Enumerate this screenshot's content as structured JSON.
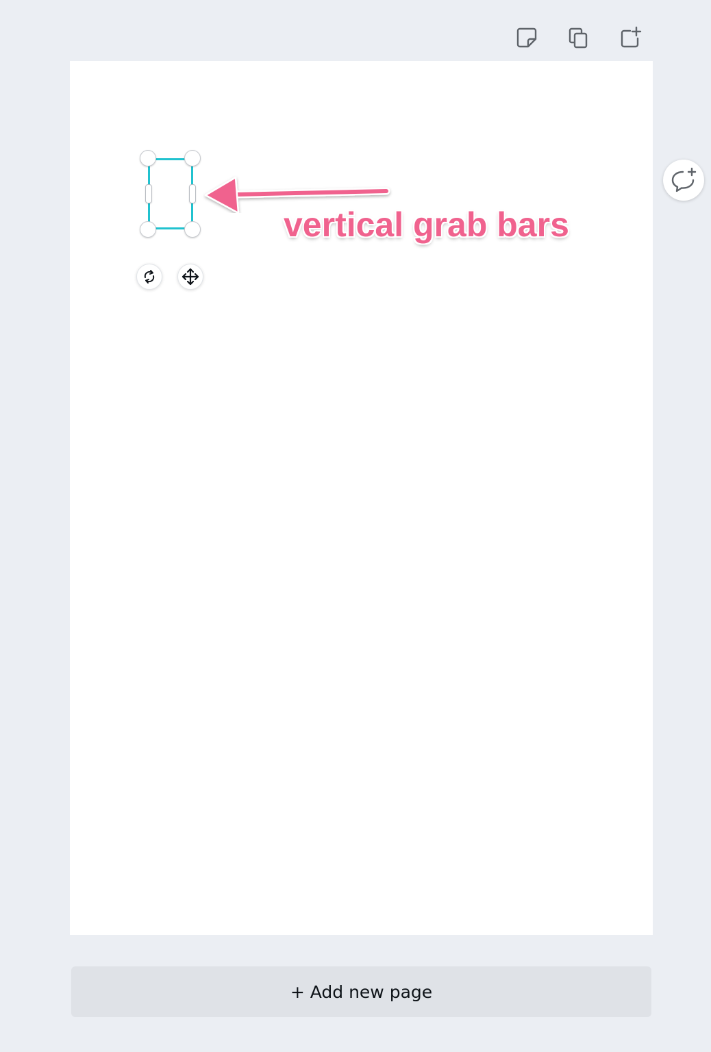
{
  "toolbar": {
    "icons": [
      "sticky-note-icon",
      "duplicate-page-icon",
      "add-page-icon"
    ]
  },
  "selection": {
    "controls": [
      "rotate-icon",
      "move-icon"
    ]
  },
  "annotation": {
    "text": "vertical grab bars",
    "color": "#f0628e"
  },
  "comment": {
    "icon": "add-comment-icon"
  },
  "add_page": {
    "label": "+ Add new page"
  },
  "colors": {
    "background": "#ebeef3",
    "page": "#ffffff",
    "selection_border": "#21c2cf",
    "button_bg": "#dfe2e7"
  }
}
